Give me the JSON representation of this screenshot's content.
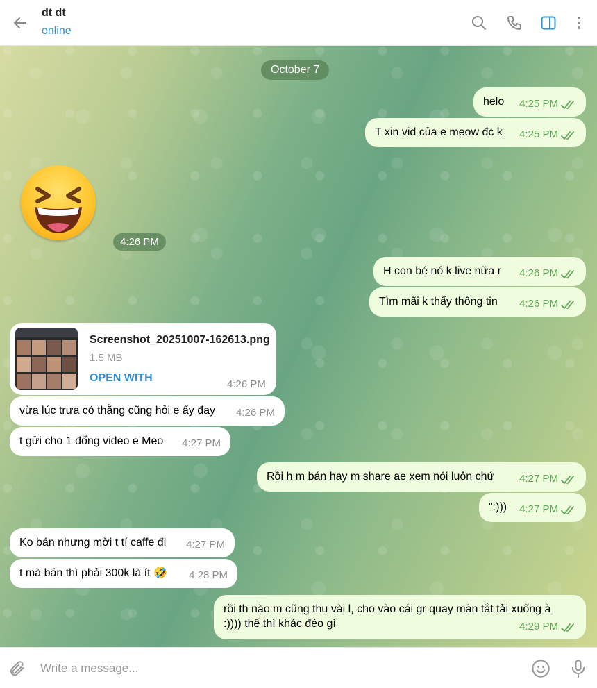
{
  "header": {
    "name": "dt dt",
    "status": "online"
  },
  "chat": {
    "date_pill": "October 7",
    "sticker_time": "4:26 PM",
    "messages": [
      {
        "text": "helo",
        "time": "4:25 PM"
      },
      {
        "text": "T xin vid của e meow đc k",
        "time": "4:25 PM"
      },
      {
        "text": "H con bé nó k live nữa r",
        "time": "4:26 PM"
      },
      {
        "text": "Tìm mãi k thấy thông tin",
        "time": "4:26 PM"
      },
      {
        "text": "vừa lúc trưa có thằng cũng hỏi e ấy đay",
        "time": "4:26 PM"
      },
      {
        "text": "t gửi cho 1 đống video e Meo",
        "time": "4:27 PM"
      },
      {
        "text": "Rồi h m bán hay m share ae xem nói luôn chứ",
        "time": "4:27 PM"
      },
      {
        "text": "\":)))",
        "time": "4:27 PM"
      },
      {
        "text": "Ko bán nhưng mời t tí caffe đi",
        "time": "4:27 PM"
      },
      {
        "text": "t mà bán thì phải 300k là ít 🤣",
        "time": "4:28 PM"
      },
      {
        "text_line1": "rồi th nào m cũng thu vài l, cho vào cái gr quay màn tắt tải xuống à",
        "text_line2": ":)))) thế thì khác đéo gì",
        "time": "4:29 PM"
      }
    ],
    "file": {
      "name": "Screenshot_20251007-162613.png",
      "size": "1.5 MB",
      "action": "OPEN WITH",
      "time": "4:26 PM"
    }
  },
  "composer": {
    "placeholder": "Write a message..."
  },
  "colors": {
    "accent": "#3390cc",
    "outgoing": "#effdde",
    "check": "#5ea654"
  }
}
